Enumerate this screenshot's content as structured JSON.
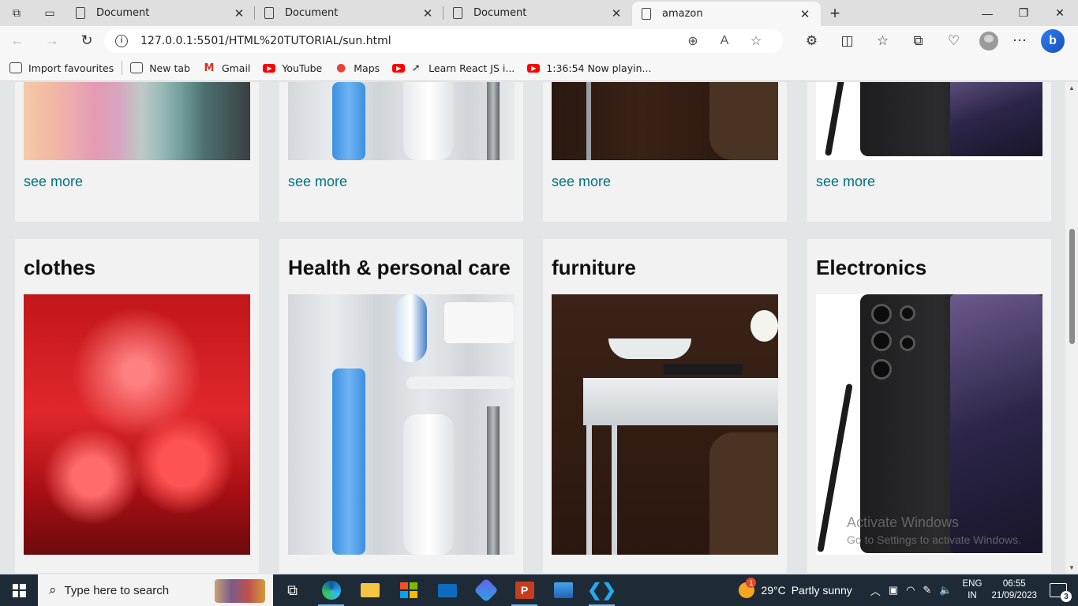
{
  "browser": {
    "tabs": [
      {
        "label": "Document",
        "active": false
      },
      {
        "label": "Document",
        "active": false
      },
      {
        "label": "Document",
        "active": false
      },
      {
        "label": "amazon",
        "active": true
      }
    ],
    "url": "127.0.0.1:5501/HTML%20TUTORIAL/sun.html",
    "favourites": [
      {
        "label": "Import favourites",
        "icon": "import-icon"
      },
      {
        "label": "New tab",
        "icon": "new-tab-icon"
      },
      {
        "label": "Gmail",
        "icon": "gmail-icon"
      },
      {
        "label": "YouTube",
        "icon": "youtube-icon"
      },
      {
        "label": "Maps",
        "icon": "maps-icon"
      },
      {
        "label": "Learn React JS i...",
        "icon": "rocket-icon"
      },
      {
        "label": "1:36:54 Now playin...",
        "icon": "youtube-icon"
      }
    ]
  },
  "page": {
    "top_cards": [
      {
        "link": "see more",
        "image": "clothes-image"
      },
      {
        "link": "see more",
        "image": "health-image"
      },
      {
        "link": "see more",
        "image": "furniture-image"
      },
      {
        "link": "see more",
        "image": "electronics-image"
      }
    ],
    "cards": [
      {
        "title": "clothes",
        "image": "clothes-image"
      },
      {
        "title": "Health & personal care",
        "image": "health-image"
      },
      {
        "title": "furniture",
        "image": "furniture-image"
      },
      {
        "title": "Electronics",
        "image": "electronics-image"
      }
    ],
    "watermark": {
      "title": "Activate Windows",
      "subtitle": "Go to Settings to activate Windows."
    }
  },
  "taskbar": {
    "search_placeholder": "Type here to search",
    "weather": {
      "temp": "29°C",
      "condition": "Partly sunny",
      "badge": "1"
    },
    "language": {
      "line1": "ENG",
      "line2": "IN"
    },
    "clock": {
      "time": "06:55",
      "date": "21/09/2023"
    },
    "notifications": "3"
  },
  "colors": {
    "link": "#007185",
    "card_bg": "#f2f2f2",
    "page_bg": "#e3e6e6",
    "taskbar_bg": "#1e2b37"
  }
}
